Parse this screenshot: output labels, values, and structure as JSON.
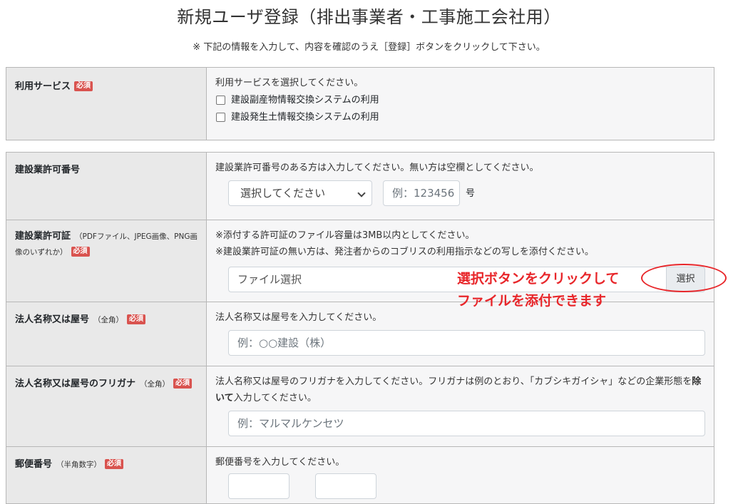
{
  "header": {
    "title": "新規ユーザ登録（排出事業者・工事施工会社用）",
    "subtitle": "※ 下記の情報を入力して、内容を確認のうえ［登録］ボタンをクリックして下さい。"
  },
  "required_label": "必須",
  "service": {
    "label": "利用サービス",
    "hint": "利用サービスを選択してください。",
    "options": [
      "建設副産物情報交換システムの利用",
      "建設発生土情報交換システムの利用"
    ]
  },
  "permit_number": {
    "label": "建設業許可番号",
    "hint": "建設業許可番号のある方は入力してください。無い方は空欄としてください。",
    "select_value": "選択してください",
    "input_placeholder": "例：123456",
    "suffix": "号"
  },
  "permit_cert": {
    "label": "建設業許可証",
    "note": "（PDFファイル、JPEG画像、PNG画像のいずれか）",
    "hint1": "※添付する許可証のファイル容量は3MB以内としてください。",
    "hint2": "※建設業許可証の無い方は、発注者からのコブリスの利用指示などの写しを添付ください。",
    "file_placeholder": "ファイル選択",
    "browse_label": "選択"
  },
  "company_name": {
    "label": "法人名称又は屋号",
    "note": "（全角）",
    "hint": "法人名称又は屋号を入力してください。",
    "placeholder": "例：○○建設（株）"
  },
  "company_kana": {
    "label": "法人名称又は屋号のフリガナ",
    "note": "（全角）",
    "hint_pre": "法人名称又は屋号のフリガナを入力してください。フリガナは例のとおり、「カブシキガイシャ」などの企業形態を",
    "hint_bold": "除いて",
    "hint_post": "入力してください。",
    "placeholder": "例：マルマルケンセツ"
  },
  "postal": {
    "label": "郵便番号",
    "note": "（半角数字）",
    "hint": "郵便番号を入力してください。"
  },
  "annotation": {
    "line1": "選択ボタンをクリックして",
    "line2": "ファイルを添付できます",
    "color": "#e8262a"
  }
}
